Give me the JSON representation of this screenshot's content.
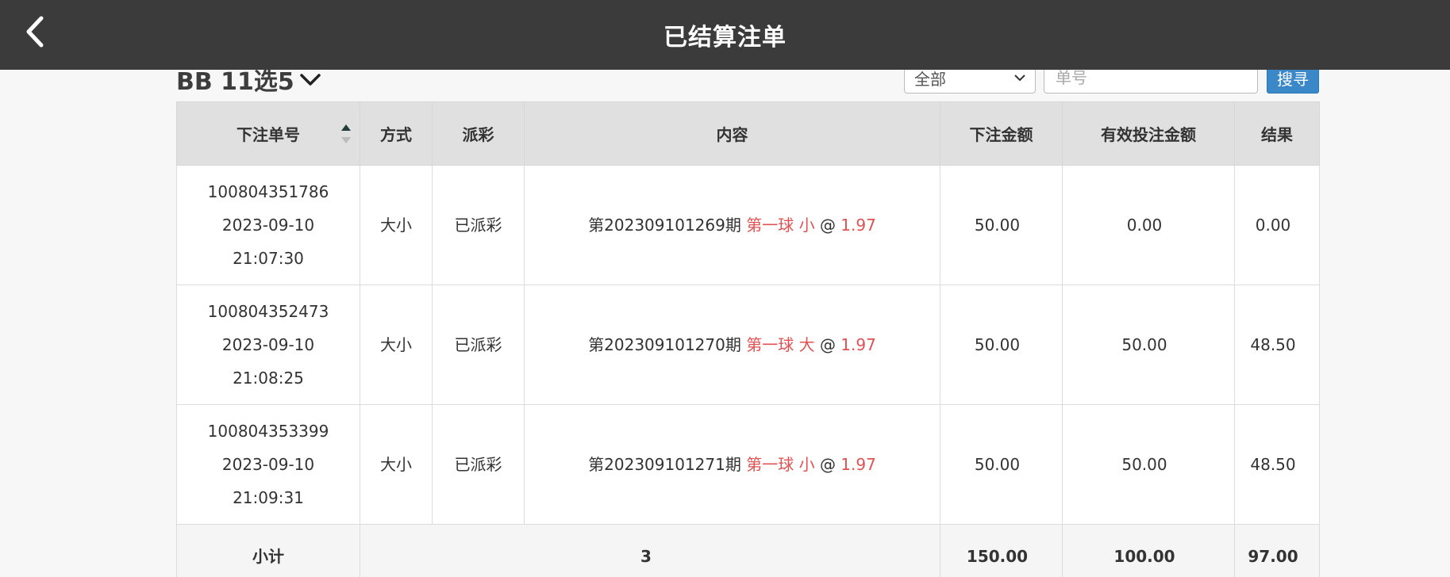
{
  "header": {
    "title": "已结算注单"
  },
  "toolbar": {
    "game_name": "BB 11选5",
    "filter_value": "全部",
    "order_placeholder": "单号",
    "search_label": "搜寻"
  },
  "table": {
    "columns": {
      "order_no": "下注单号",
      "method": "方式",
      "status": "派彩",
      "content": "内容",
      "bet_amount": "下注金额",
      "valid_amount": "有效投注金额",
      "result": "结果"
    },
    "rows": [
      {
        "order_no": "100804351786",
        "date": "2023-09-10",
        "time": "21:07:30",
        "method": "大小",
        "status": "已派彩",
        "period": "第202309101269期",
        "ball": "第一球",
        "pick": "小",
        "at": "@",
        "odds": "1.97",
        "bet_amount": "50.00",
        "valid_amount": "0.00",
        "result": "0.00"
      },
      {
        "order_no": "100804352473",
        "date": "2023-09-10",
        "time": "21:08:25",
        "method": "大小",
        "status": "已派彩",
        "period": "第202309101270期",
        "ball": "第一球",
        "pick": "大",
        "at": "@",
        "odds": "1.97",
        "bet_amount": "50.00",
        "valid_amount": "50.00",
        "result": "48.50"
      },
      {
        "order_no": "100804353399",
        "date": "2023-09-10",
        "time": "21:09:31",
        "method": "大小",
        "status": "已派彩",
        "period": "第202309101271期",
        "ball": "第一球",
        "pick": "小",
        "at": "@",
        "odds": "1.97",
        "bet_amount": "50.00",
        "valid_amount": "50.00",
        "result": "48.50"
      }
    ],
    "subtotal": {
      "label": "小计",
      "count": "3",
      "bet_amount": "150.00",
      "valid_amount": "100.00",
      "result": "97.00"
    }
  },
  "colors": {
    "header_bg": "#3b3b3b",
    "accent_blue": "#3b88c9",
    "highlight_red": "#e05252"
  },
  "icons": [
    "back-chevron-icon",
    "chevron-down-icon",
    "sort-icon",
    "select-arrow-icon"
  ]
}
